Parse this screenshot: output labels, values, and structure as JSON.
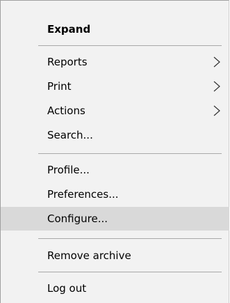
{
  "menu": {
    "items": [
      {
        "label": "Expand",
        "bold": true
      },
      {
        "label": "Reports",
        "submenu": true
      },
      {
        "label": "Print",
        "submenu": true
      },
      {
        "label": "Actions",
        "submenu": true
      },
      {
        "label": "Search..."
      },
      {
        "label": "Profile..."
      },
      {
        "label": "Preferences..."
      },
      {
        "label": "Configure...",
        "highlighted": true
      },
      {
        "label": "Remove archive"
      },
      {
        "label": "Log out"
      }
    ]
  },
  "icons": {
    "submenu": "chevron-right-icon"
  },
  "colors": {
    "menu_background": "#f2f2f2",
    "highlight": "#d9d9d9",
    "separator": "#a9a9a9",
    "text": "#000000"
  }
}
